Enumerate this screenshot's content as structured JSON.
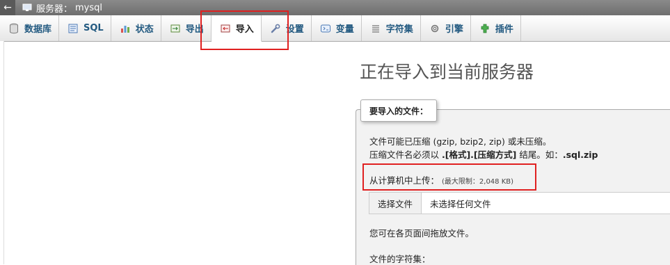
{
  "titlebar": {
    "back_symbol": "←",
    "label": "服务器：",
    "server": "mysql"
  },
  "tabs": [
    {
      "label": "数据库",
      "icon": "database-icon"
    },
    {
      "label": "SQL",
      "icon": "sql-icon"
    },
    {
      "label": "状态",
      "icon": "status-chart-icon"
    },
    {
      "label": "导出",
      "icon": "export-icon"
    },
    {
      "label": "导入",
      "icon": "import-icon",
      "active": true
    },
    {
      "label": "设置",
      "icon": "wrench-icon"
    },
    {
      "label": "变量",
      "icon": "variables-icon"
    },
    {
      "label": "字符集",
      "icon": "charset-icon"
    },
    {
      "label": "引擎",
      "icon": "engine-icon"
    },
    {
      "label": "插件",
      "icon": "plugin-icon"
    }
  ],
  "main": {
    "title": "正在导入到当前服务器",
    "legend": "要导入的文件：",
    "compress_note_1": "文件可能已压缩 (gzip, bzip2, zip) 或未压缩。",
    "compress_note_2_prefix": "压缩文件名必须以 ",
    "compress_note_2_format": ".[格式].[压缩方式]",
    "compress_note_2_mid": " 结尾。如：",
    "compress_note_2_example": ".sql.zip",
    "upload_label": "从计算机中上传：",
    "upload_limit": "(最大限制：2,048 KB)",
    "choose_button": "选择文件",
    "no_file": "未选择任何文件",
    "drag_note": "您可在各页面间拖放文件。",
    "charset_label": "文件的字符集："
  },
  "colors": {
    "highlight": "#e02020",
    "tab_text": "#235a81",
    "title_text": "#555555"
  }
}
